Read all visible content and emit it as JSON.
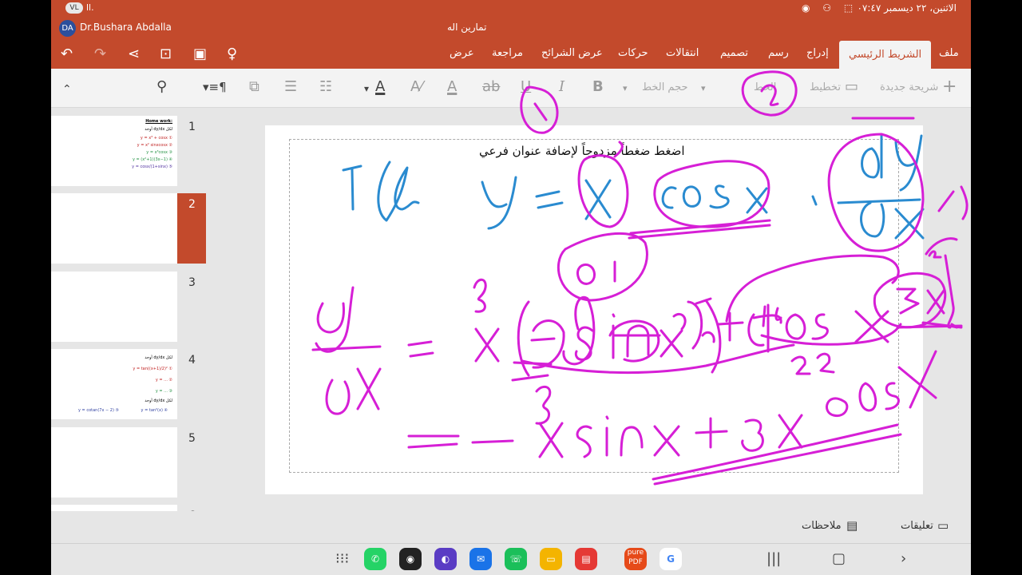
{
  "status_bar": {
    "time_date": "الاثنين، ٢٢ ديسمبر ٠٧:٤٧",
    "badge": "VL",
    "signal": "ll."
  },
  "titlebar": {
    "avatar_initials": "DA",
    "user_name": "Dr.Bushara Abdalla",
    "document_title": "تمارين اله"
  },
  "ribbon": {
    "tabs": [
      "ملف",
      "الشريط الرئيسي",
      "إدراج",
      "رسم",
      "تصميم",
      "انتقالات",
      "حركات",
      "عرض الشرائح",
      "مراجعة",
      "عرض"
    ],
    "active_tab": "الشريط الرئيسي"
  },
  "toolbar": {
    "new_slide": "شريحة جديدة",
    "layout": "تخطيط",
    "font_name": "الخط",
    "font_size": "حجم الخط",
    "bold": "B",
    "italic": "I",
    "underline": "U",
    "strike": "ab",
    "font_color": "A",
    "highlight": "A"
  },
  "thumbnails": [
    {
      "number": "1",
      "lines": [
        "Home work:",
        "أوجد dy/dx لكل",
        "y = x³ + cosx ①",
        "y = x² sinxcosx ②",
        "y = x³cosx ③",
        "y = (x²+1)(3x−1) ④",
        "y = cosx/(1+sinx) ⑤"
      ]
    },
    {
      "number": "2",
      "lines": []
    },
    {
      "number": "3",
      "lines": []
    },
    {
      "number": "4",
      "lines": [
        "أوجد dy/dx لكل",
        "y = tan((x+1)/2)² ①",
        "y = ... ②",
        "y = ... ③",
        "أوجد dy/dx لكل",
        "y = cotan(7x − 2) ⑤",
        "y = tan²(x) ④"
      ]
    },
    {
      "number": "5",
      "lines": []
    },
    {
      "number": "6",
      "lines": []
    }
  ],
  "selected_slide": "2",
  "slide": {
    "subtitle_placeholder": "اضغط ضغطاً مزدوجاً لإضافة عنوان فرعي"
  },
  "notes_bar": {
    "notes": "ملاحظات",
    "comments": "تعليقات"
  },
  "colors": {
    "accent": "#c34a2c",
    "ink_blue": "#2a8bd0",
    "ink_magenta": "#d61fd6"
  }
}
